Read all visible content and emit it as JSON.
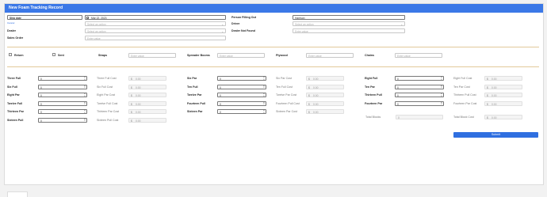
{
  "title": "New Foam Tracking Record",
  "fields": {
    "ship_date": {
      "label": "Ship date",
      "value": "Mar 22, 2023"
    },
    "person_filling_out": {
      "label": "Person Filling Out",
      "value": "Harrison"
    },
    "cancel_link": "Cancel",
    "sub_row_select_placeholder": "Select an option",
    "driver": {
      "label": "Driver",
      "placeholder": "Select an option"
    },
    "dealer": {
      "label": "Dealer",
      "placeholder": "Select an option"
    },
    "dealer_not_found": {
      "label": "Dealer Not Found",
      "placeholder": "Enter value"
    },
    "sales_order": {
      "label": "Sales Order",
      "placeholder": "Enter value"
    }
  },
  "options": {
    "return_label": "Return",
    "sent_label": "Sent",
    "straps": {
      "label": "Straps",
      "placeholder": "Enter value"
    },
    "spreader_booms": {
      "label": "Spreader Booms",
      "placeholder": "Enter value"
    },
    "plywood": {
      "label": "Plywood",
      "placeholder": "Enter value"
    },
    "chains": {
      "label": "Chains",
      "placeholder": "Enter value"
    }
  },
  "default_qty": "0",
  "currency": "$",
  "cost_value": "0.00",
  "items_col1": [
    {
      "label": "Three Full",
      "cost_label": "Three Full Cost"
    },
    {
      "label": "Six Full",
      "cost_label": "Six Full Cost"
    },
    {
      "label": "Eight Par",
      "cost_label": "Eight Par Cost"
    },
    {
      "label": "Twelve Full",
      "cost_label": "Twelve Full Cost"
    },
    {
      "label": "Thirteen Par",
      "cost_label": "Thirteen Par Cost"
    },
    {
      "label": "Sixteen Pull",
      "cost_label": "Sixteen Pull Cost"
    }
  ],
  "items_col2": [
    {
      "label": "Six Par",
      "cost_label": "Six Par Cost"
    },
    {
      "label": "Ten Full",
      "cost_label": "Ten Full Cost"
    },
    {
      "label": "Twelve Par",
      "cost_label": "Twelve Par Cost"
    },
    {
      "label": "Fourteen Pull",
      "cost_label": "Fourteen Pull Cost"
    },
    {
      "label": "Sixteen Par",
      "cost_label": "Sixteen Par Cost"
    }
  ],
  "items_col3": [
    {
      "label": "Eight Full",
      "cost_label": "Eight Full Cost"
    },
    {
      "label": "Ten Par",
      "cost_label": "Ten Par Cost"
    },
    {
      "label": "Thirteen Pull",
      "cost_label": "Thirteen Pull Cost"
    },
    {
      "label": "Fourteen Par",
      "cost_label": "Fourteen Par Cost"
    }
  ],
  "total_blocks": {
    "label": "Total Blocks",
    "value": "0"
  },
  "total_block_cost": {
    "label": "Total Block Cost",
    "value": "0.00"
  },
  "submit_label": "Submit"
}
